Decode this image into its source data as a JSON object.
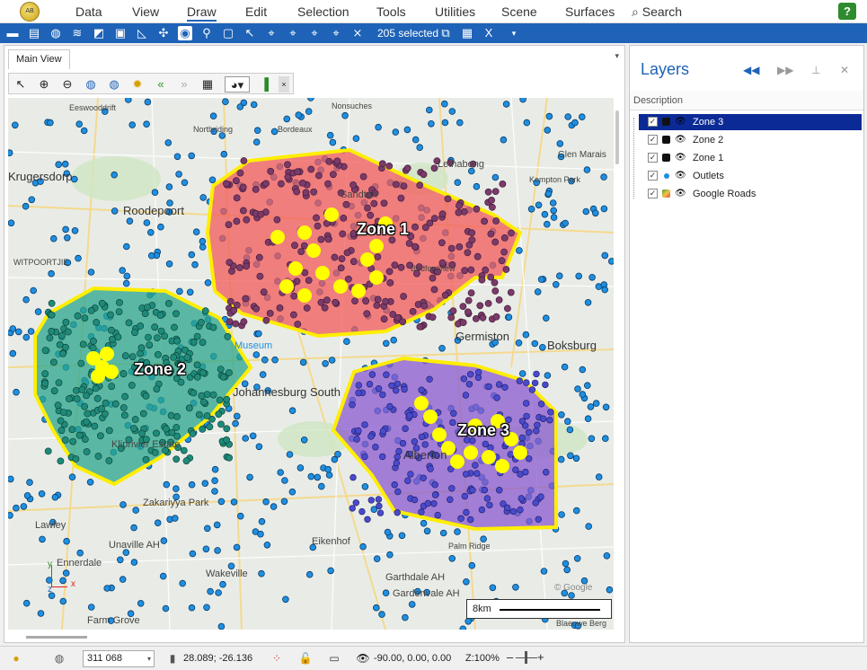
{
  "menubar": {
    "logo": "AB",
    "items": [
      "Data",
      "View",
      "Draw",
      "Edit",
      "Selection",
      "Tools",
      "Utilities",
      "Scene",
      "Surfaces"
    ],
    "active": "Draw",
    "search_label": "Search",
    "help_label": "?"
  },
  "toolbar": {
    "selected_count": "205 selected",
    "icons": [
      "folder-icon",
      "print-icon",
      "globe-add-icon",
      "layers-icon",
      "map-icon",
      "image-icon",
      "measure-icon",
      "point-icon",
      "globe-icon",
      "pin-icon",
      "select-rect-icon",
      "arrow-select-icon",
      "node-edit-icon",
      "node-move-icon",
      "node-add-icon",
      "node-delete-icon",
      "clear-selection-icon",
      "copy-icon",
      "table-icon",
      "excel-icon",
      "dropdown-icon"
    ]
  },
  "main_view": {
    "tab_label": "Main View",
    "map_tools": [
      "pointer-icon",
      "zoom-in-icon",
      "zoom-out-icon",
      "globe-view-icon",
      "globe-full-icon",
      "settings-icon",
      "back-icon",
      "forward-icon",
      "grid-icon",
      "color-icon",
      "bookmark-icon"
    ],
    "map_labels": {
      "places": [
        "Krugersdorp",
        "Roodepoort",
        "WITPOORTJIE",
        "Johannesburg South",
        "Kliprivier Estate",
        "Zakariyya Park",
        "Lawley",
        "Unaville AH",
        "Ennerdale",
        "Wakeville",
        "Eikenhof",
        "Farm Grove",
        "Garthdale AH",
        "Gardenvale AH",
        "Germiston",
        "Boksburg",
        "Lethabong",
        "Alberton",
        "Sandton",
        "Bedfordview",
        "Glen Marais",
        "Kempton Park",
        "Museum",
        "Palm Ridge",
        "Nonsuches",
        "Northriding",
        "Bordeaux",
        "Eeswooddrift",
        "Blaeuwe Berg"
      ],
      "zones": [
        "Zone 1",
        "Zone 2",
        "Zone 3"
      ],
      "scale": "8km",
      "attribution": "© Google",
      "axis_z": "z",
      "axis_x": "x",
      "axis_y": "y"
    }
  },
  "layers": {
    "title": "Layers",
    "column": "Description",
    "items": [
      {
        "name": "Zone 3",
        "checked": true,
        "color": "#7a55c8",
        "selected": true
      },
      {
        "name": "Zone 2",
        "checked": true,
        "color": "#22a38f",
        "selected": false
      },
      {
        "name": "Zone 1",
        "checked": true,
        "color": "#e24848",
        "selected": false
      },
      {
        "name": "Outlets",
        "checked": true,
        "color": "#1f8fe0",
        "selected": false
      },
      {
        "name": "Google Roads",
        "checked": true,
        "color": "#3a9a3a",
        "selected": false
      }
    ]
  },
  "statusbar": {
    "zoom_value": "311 068",
    "coords": "28.089; -26.136",
    "rotation": "-90.00, 0.00, 0.00",
    "zoom_pct": "Z:100%"
  },
  "colors": {
    "accent": "#1e63b7",
    "outlet": "#1f8fe0",
    "zone1": "#f25a5a",
    "zone2": "#2aa68c",
    "zone3": "#8a5ad0",
    "highlight": "#ffff00"
  }
}
